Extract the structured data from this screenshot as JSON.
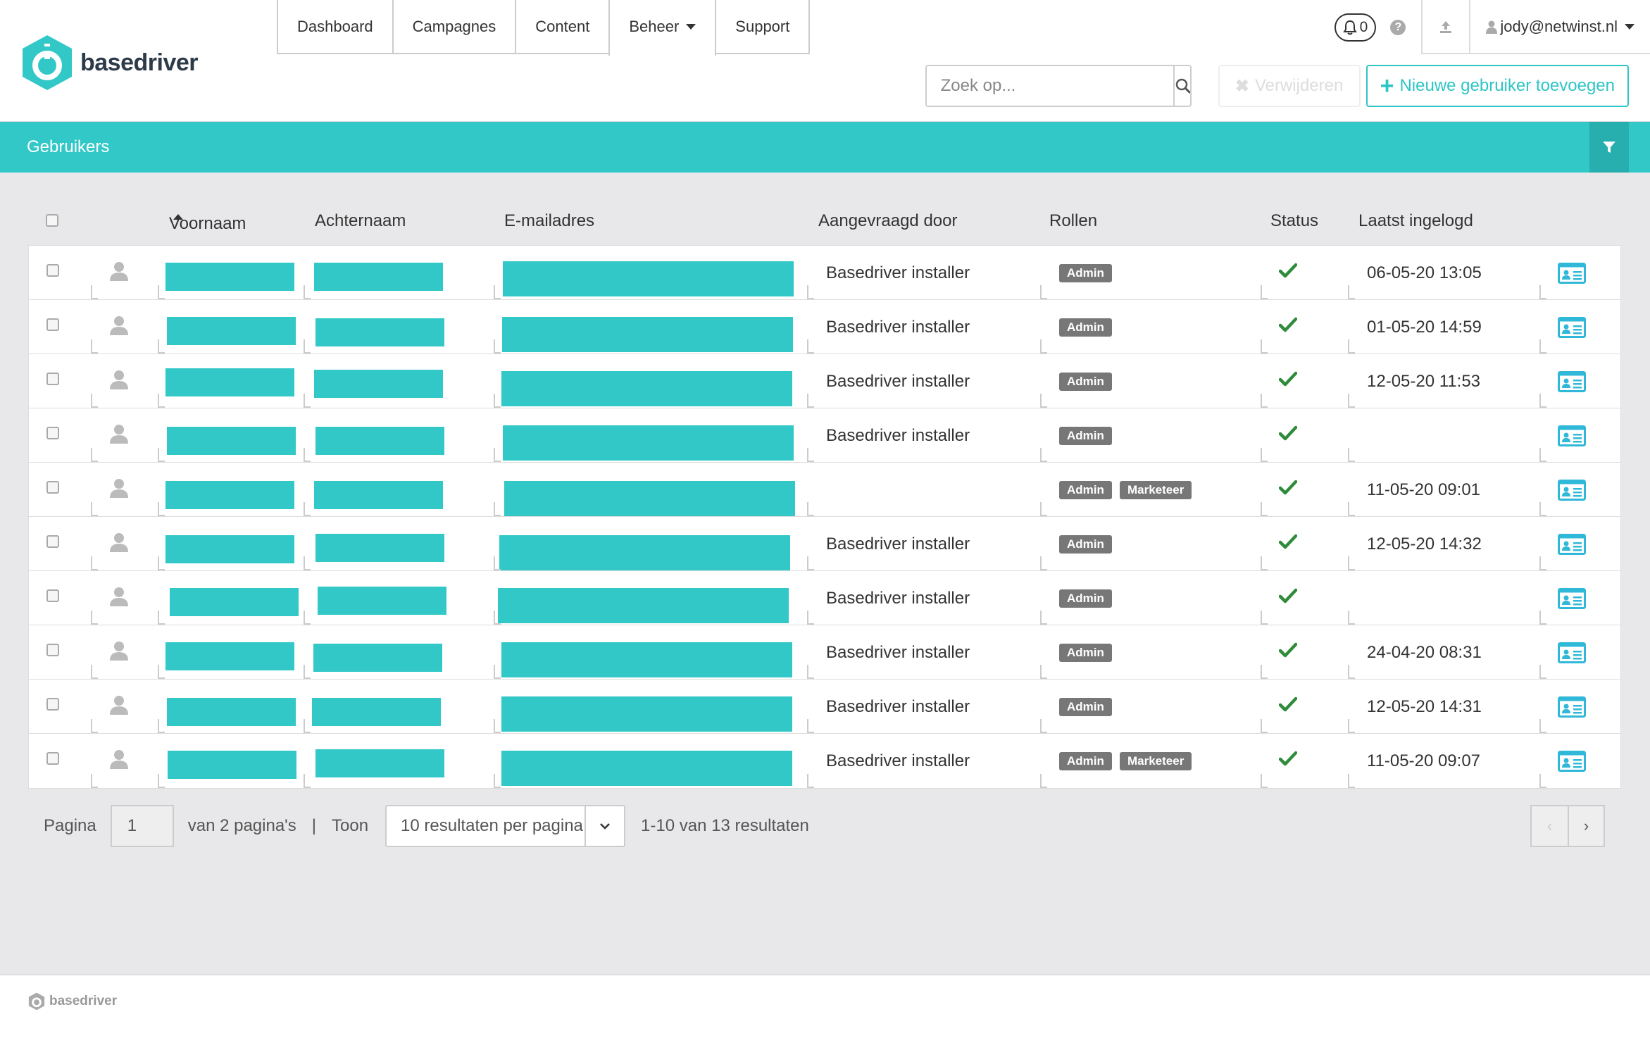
{
  "app": {
    "logo_text": "basedriver",
    "brand_color": "#32c8c8"
  },
  "nav": {
    "items": [
      {
        "label": "Dashboard"
      },
      {
        "label": "Campagnes"
      },
      {
        "label": "Content"
      },
      {
        "label": "Beheer"
      },
      {
        "label": "Support"
      }
    ],
    "notifications_count": "0",
    "user_email": "jody@netwinst.nl"
  },
  "toolbar": {
    "search_placeholder": "Zoek op...",
    "delete_label": "Verwijderen",
    "add_label": "Nieuwe gebruiker toevoegen"
  },
  "page": {
    "title": "Gebruikers"
  },
  "table": {
    "headers": {
      "firstname": "Voornaam",
      "lastname": "Achternaam",
      "email": "E-mailadres",
      "requested_by": "Aangevraagd door",
      "roles": "Rollen",
      "status": "Status",
      "last_login": "Laatst ingelogd"
    },
    "rows": [
      {
        "requested_by": "Basedriver installer",
        "roles": [
          "Admin"
        ],
        "last_login": "06-05-20 13:05"
      },
      {
        "requested_by": "Basedriver installer",
        "roles": [
          "Admin"
        ],
        "last_login": "01-05-20 14:59"
      },
      {
        "requested_by": "Basedriver installer",
        "roles": [
          "Admin"
        ],
        "last_login": "12-05-20 11:53"
      },
      {
        "requested_by": "Basedriver installer",
        "roles": [
          "Admin"
        ],
        "last_login": ""
      },
      {
        "requested_by": "",
        "roles": [
          "Admin",
          "Marketeer"
        ],
        "last_login": "11-05-20 09:01"
      },
      {
        "requested_by": "Basedriver installer",
        "roles": [
          "Admin"
        ],
        "last_login": "12-05-20 14:32"
      },
      {
        "requested_by": "Basedriver installer",
        "roles": [
          "Admin"
        ],
        "last_login": ""
      },
      {
        "requested_by": "Basedriver installer",
        "roles": [
          "Admin"
        ],
        "last_login": "24-04-20 08:31"
      },
      {
        "requested_by": "Basedriver installer",
        "roles": [
          "Admin"
        ],
        "last_login": "12-05-20 14:31"
      },
      {
        "requested_by": "Basedriver installer",
        "roles": [
          "Admin",
          "Marketeer"
        ],
        "last_login": "11-05-20 09:07"
      }
    ]
  },
  "pagination": {
    "page_label": "Pagina",
    "current_page": "1",
    "of_pages": "van 2 pagina's",
    "separator": "|",
    "show_label": "Toon",
    "per_page": "10 resultaten per pagina",
    "summary": "1-10 van 13 resultaten",
    "prev": "‹",
    "next": "›"
  },
  "footer": {
    "logo_text": "basedriver"
  }
}
